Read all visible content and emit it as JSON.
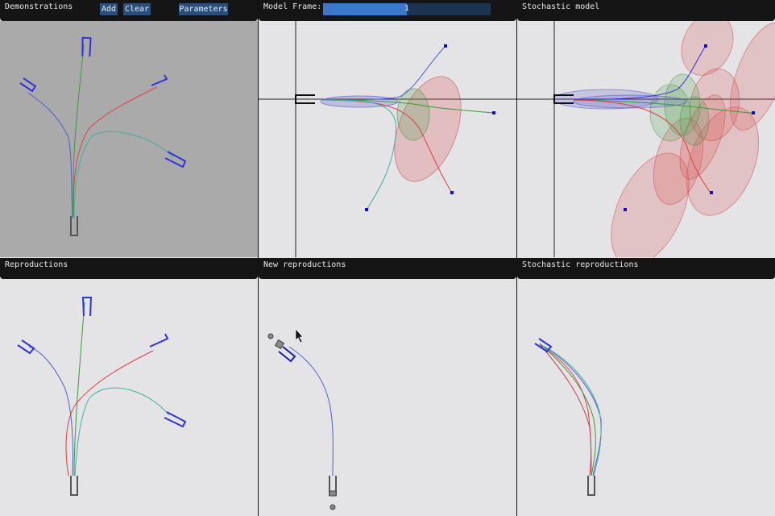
{
  "panels": {
    "demonstrations": {
      "title": "Demonstrations",
      "add_label": "Add",
      "clear_label": "Clear",
      "parameters_label": "Parameters"
    },
    "model_frame": {
      "title": "Model Frame:",
      "slider": {
        "value": "1",
        "fraction": 0.5
      }
    },
    "stochastic_model": {
      "title": "Stochastic model"
    },
    "reproductions": {
      "title": "Reproductions"
    },
    "new_reproductions": {
      "title": "New reproductions"
    },
    "stochastic_reproductions": {
      "title": "Stochastic reproductions"
    }
  },
  "colors": {
    "background_dark": "#aaaaaa",
    "background_light": "#e4e3e6",
    "frame_blue": "#3232dc",
    "traj_red": "#e04040",
    "traj_green": "#3a9a3a",
    "traj_blue": "#5060d0",
    "traj_teal": "#40b0a0"
  }
}
